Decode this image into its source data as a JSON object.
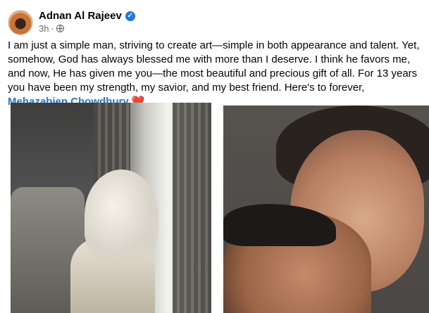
{
  "post": {
    "author": "Adnan Al Rajeev",
    "verified_symbol": "✓",
    "time": "3h",
    "separator": "·",
    "text": "I am just a simple man, striving to create art—simple in both appearance and talent. Yet, somehow, God has always blessed me with more than I deserve. I think he favors me, and now, He has given me you—the most beautiful and precious gift of all. For 13 years you have been my strength, my savior, and my best friend. Here's to forever, ",
    "mention": "Mehazabien Chowdhury",
    "heart": "❤️"
  },
  "colors": {
    "link": "#1877f2",
    "meta": "#65676b",
    "text": "#050505"
  }
}
